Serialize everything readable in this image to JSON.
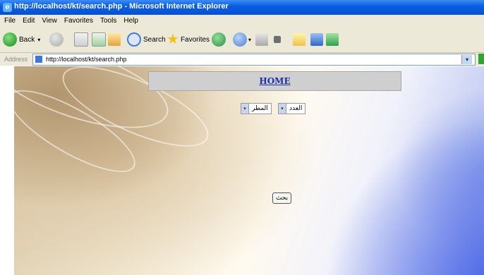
{
  "window": {
    "title": "http://localhost/kt/search.php - Microsoft Internet Explorer"
  },
  "menu": [
    "File",
    "Edit",
    "View",
    "Favorites",
    "Tools",
    "Help"
  ],
  "toolbar": {
    "back_label": "Back",
    "search_label": "Search",
    "favorites_label": "Favorites"
  },
  "address": {
    "label": "Address",
    "url": "http://localhost/kt/search.php"
  },
  "page": {
    "home_link": "HOME",
    "select_1": "المطر",
    "select_2": "العدد",
    "search_button": "بحث"
  },
  "colors": {
    "titlebar": "#0a5fe0",
    "chrome": "#ece9d8",
    "link": "#1e2ea8",
    "home_bar": "#cfcfcf"
  }
}
